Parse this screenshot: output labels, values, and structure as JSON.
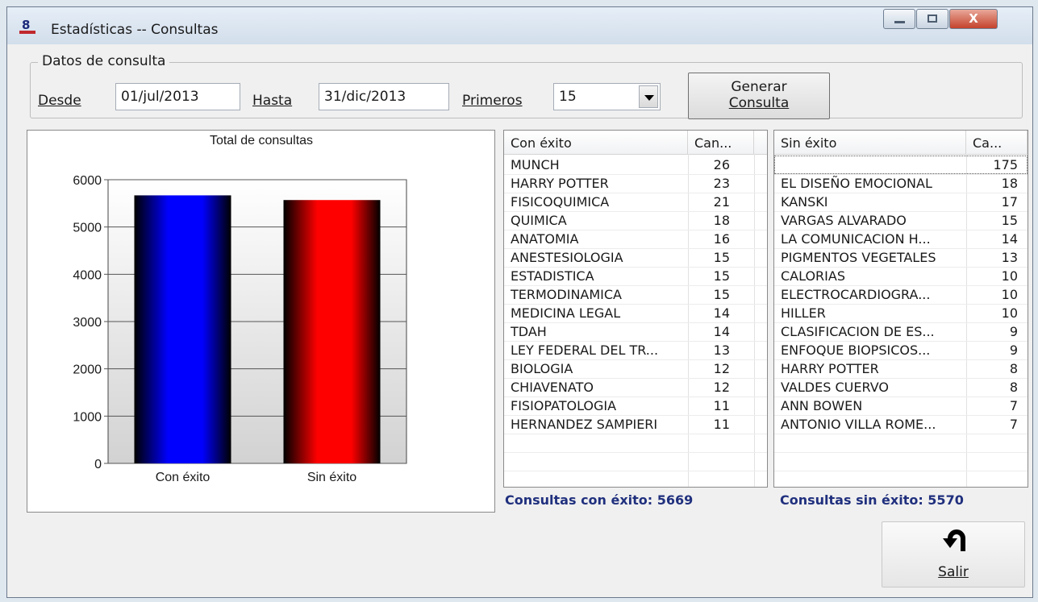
{
  "window": {
    "title": "Estadísticas -- Consultas"
  },
  "query": {
    "group_title": "Datos de consulta",
    "desde_label": "Desde",
    "desde_value": "01/jul/2013",
    "hasta_label": "Hasta",
    "hasta_value": "31/dic/2013",
    "primeros_label": "Primeros",
    "primeros_value": "15",
    "generate_line1": "Generar",
    "generate_line2": "Consulta"
  },
  "chart_data": {
    "type": "bar",
    "title": "Total de consultas",
    "categories": [
      "Con éxito",
      "Sin éxito"
    ],
    "values": [
      5669,
      5570
    ],
    "colors": [
      "#0000ff",
      "#ff0000"
    ],
    "ylim": [
      0,
      6000
    ],
    "yticks": [
      0,
      1000,
      2000,
      3000,
      4000,
      5000,
      6000
    ],
    "grid": true
  },
  "success_list": {
    "headers": [
      "Con éxito",
      "Can..."
    ],
    "rows": [
      [
        "MUNCH",
        "26"
      ],
      [
        "HARRY POTTER",
        "23"
      ],
      [
        "FISICOQUIMICA",
        "21"
      ],
      [
        "QUIMICA",
        "18"
      ],
      [
        "ANATOMIA",
        "16"
      ],
      [
        "ANESTESIOLOGIA",
        "15"
      ],
      [
        "ESTADISTICA",
        "15"
      ],
      [
        "TERMODINAMICA",
        "15"
      ],
      [
        "MEDICINA LEGAL",
        "14"
      ],
      [
        "TDAH",
        "14"
      ],
      [
        "LEY FEDERAL DEL TR...",
        "13"
      ],
      [
        "BIOLOGIA",
        "12"
      ],
      [
        "CHIAVENATO",
        "12"
      ],
      [
        "FISIOPATOLOGIA",
        "11"
      ],
      [
        "HERNANDEZ SAMPIERI",
        "11"
      ]
    ]
  },
  "failure_list": {
    "headers": [
      "Sin éxito",
      "Ca..."
    ],
    "rows": [
      [
        "",
        "175"
      ],
      [
        "EL DISEÑO EMOCIONAL",
        "18"
      ],
      [
        "KANSKI",
        "17"
      ],
      [
        "VARGAS ALVARADO",
        "15"
      ],
      [
        "LA COMUNICACION H...",
        "14"
      ],
      [
        "PIGMENTOS VEGETALES",
        "13"
      ],
      [
        "CALORIAS",
        "10"
      ],
      [
        "ELECTROCARDIOGRA...",
        "10"
      ],
      [
        "HILLER",
        "10"
      ],
      [
        "CLASIFICACION DE ES...",
        "9"
      ],
      [
        "ENFOQUE BIOPSICOS...",
        "9"
      ],
      [
        "HARRY POTTER",
        "8"
      ],
      [
        "VALDES CUERVO",
        "8"
      ],
      [
        "ANN BOWEN",
        "7"
      ],
      [
        "ANTONIO VILLA ROME...",
        "7"
      ]
    ]
  },
  "summary": {
    "success": "Consultas con éxito: 5669",
    "failure": "Consultas sin éxito: 5570"
  },
  "exit_button": {
    "label": "Salir",
    "icon": "u-turn-arrow-icon"
  },
  "titlebar_buttons": {
    "close_glyph": "X"
  }
}
